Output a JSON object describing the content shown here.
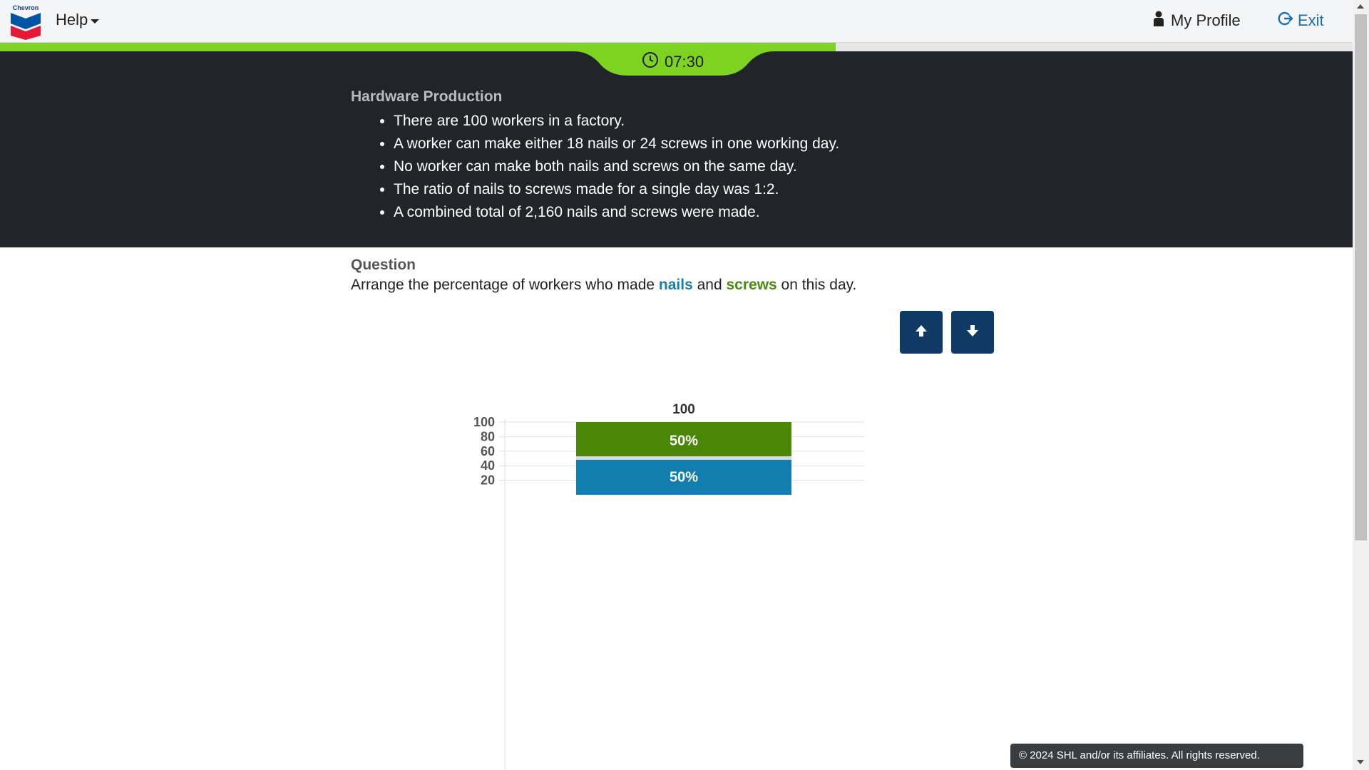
{
  "header": {
    "logo_text": "Chevron",
    "help_label": "Help",
    "profile_label": "My Profile",
    "exit_label": "Exit"
  },
  "progress": {
    "fraction": 0.618
  },
  "timer": {
    "text": "07:30"
  },
  "scenario": {
    "title": "Hardware Production",
    "facts": [
      "There are 100 workers in a factory.",
      "A worker can make either 18 nails or 24 screws in one working day.",
      "No worker can make both nails and screws on the same day.",
      "The ratio of nails to screws made for a single day was 1:2.",
      "A combined total of 2,160 nails and screws were made."
    ]
  },
  "question": {
    "title": "Question",
    "text_before": "Arrange the percentage of workers who made ",
    "nails_word": "nails",
    "text_middle": " and ",
    "screws_word": "screws",
    "text_after": " on this day."
  },
  "buttons": {
    "up_icon": "arrow-up-icon",
    "down_icon": "arrow-down-icon"
  },
  "colors": {
    "nails": "#127ead",
    "screws": "#4a8708",
    "accent": "#7ed321",
    "button": "#0f3a66"
  },
  "chart_data": {
    "type": "bar",
    "stacked": true,
    "categories": [
      ""
    ],
    "series": [
      {
        "key": "nails",
        "values": [
          50
        ],
        "label": "50%"
      },
      {
        "key": "screws",
        "values": [
          50
        ],
        "label": "50%"
      }
    ],
    "total_label": "100",
    "y_ticks": [
      "100",
      "80",
      "60",
      "40",
      "20"
    ],
    "ylim": [
      0,
      100
    ],
    "grid": true
  },
  "footer": {
    "text": "© 2024 SHL and/or its affiliates. All rights reserved."
  }
}
